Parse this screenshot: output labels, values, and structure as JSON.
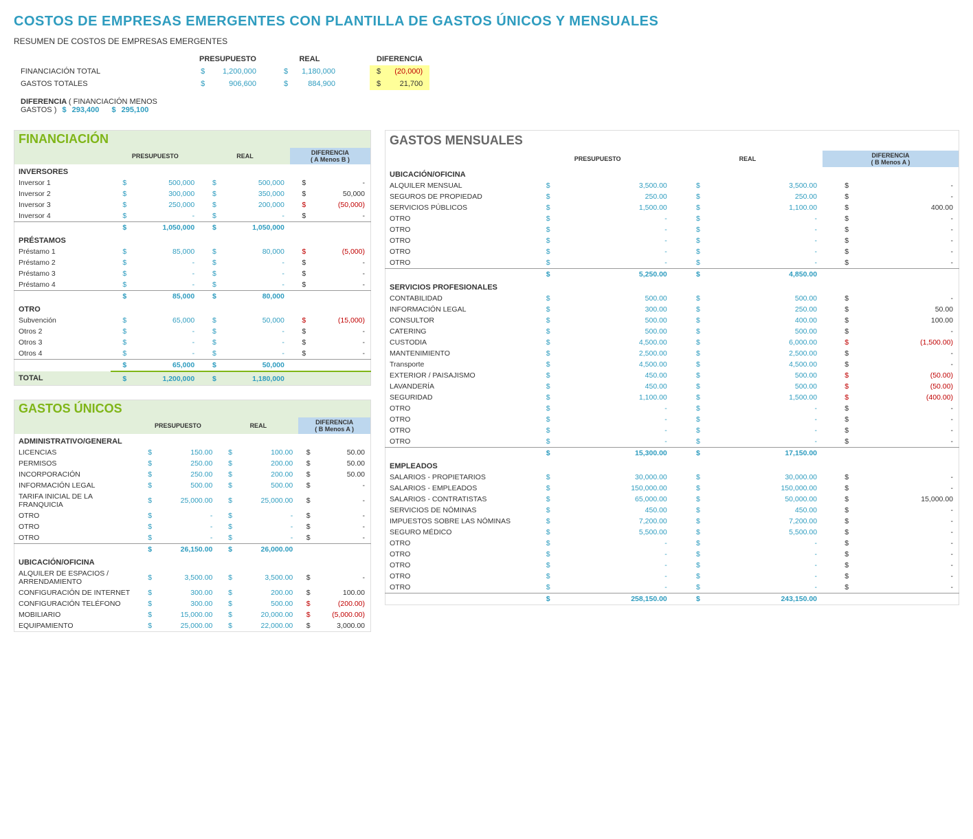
{
  "title": "COSTOS DE EMPRESAS EMERGENTES CON PLANTILLA DE GASTOS ÚNICOS Y MENSUALES",
  "subtitle": "RESUMEN DE COSTOS DE EMPRESAS EMERGENTES",
  "summary": {
    "headers": [
      "",
      "PRESUPUESTO",
      "",
      "REAL",
      "",
      "DIFERENCIA"
    ],
    "rows": [
      {
        "label": "FINANCIACIÓN TOTAL",
        "pres_sym": "$",
        "pres": "1,200,000",
        "real_sym": "$",
        "real": "1,180,000",
        "diff_sym": "$",
        "diff": "(20,000)",
        "diff_neg": true
      },
      {
        "label": "GASTOS TOTALES",
        "pres_sym": "$",
        "pres": "906,600",
        "real_sym": "$",
        "real": "884,900",
        "diff_sym": "$",
        "diff": "21,700",
        "diff_neg": false
      }
    ],
    "diferencia_label": "DIFERENCIA",
    "diferencia_note": "( FINANCIACIÓN MENOS GASTOS )",
    "diferencia_pres_sym": "$",
    "diferencia_pres": "293,400",
    "diferencia_real_sym": "$",
    "diferencia_real": "295,100"
  },
  "financiacion": {
    "title": "FINANCIACIÓN",
    "col_pres": "PRESUPUESTO",
    "col_real": "REAL",
    "col_diff": "DIFERENCIA\n( A Menos B )",
    "categories": [
      {
        "name": "INVERSORES",
        "items": [
          {
            "label": "Inversor 1",
            "pres": "500,000",
            "real": "500,000",
            "diff": "-",
            "neg": false
          },
          {
            "label": "Inversor 2",
            "pres": "300,000",
            "real": "350,000",
            "diff": "50,000",
            "neg": false
          },
          {
            "label": "Inversor 3",
            "pres": "250,000",
            "real": "200,000",
            "diff": "(50,000)",
            "neg": true
          },
          {
            "label": "Inversor 4",
            "pres": "-",
            "real": "-",
            "diff": "-",
            "neg": false
          }
        ],
        "subtotal_pres": "1,050,000",
        "subtotal_real": "1,050,000",
        "subtotal_diff": ""
      },
      {
        "name": "PRÉSTAMOS",
        "items": [
          {
            "label": "Préstamo 1",
            "pres": "85,000",
            "real": "80,000",
            "diff": "(5,000)",
            "neg": true
          },
          {
            "label": "Préstamo 2",
            "pres": "-",
            "real": "-",
            "diff": "-",
            "neg": false
          },
          {
            "label": "Préstamo 3",
            "pres": "-",
            "real": "-",
            "diff": "-",
            "neg": false
          },
          {
            "label": "Préstamo 4",
            "pres": "-",
            "real": "-",
            "diff": "-",
            "neg": false
          }
        ],
        "subtotal_pres": "85,000",
        "subtotal_real": "80,000",
        "subtotal_diff": ""
      },
      {
        "name": "OTRO",
        "items": [
          {
            "label": "Subvención",
            "pres": "65,000",
            "real": "50,000",
            "diff": "(15,000)",
            "neg": true
          },
          {
            "label": "Otros 2",
            "pres": "-",
            "real": "-",
            "diff": "-",
            "neg": false
          },
          {
            "label": "Otros 3",
            "pres": "-",
            "real": "-",
            "diff": "-",
            "neg": false
          },
          {
            "label": "Otros 4",
            "pres": "-",
            "real": "-",
            "diff": "-",
            "neg": false
          }
        ],
        "subtotal_pres": "65,000",
        "subtotal_real": "50,000",
        "subtotal_diff": ""
      }
    ],
    "total_label": "TOTAL",
    "total_pres": "1,200,000",
    "total_real": "1,180,000",
    "total_diff": ""
  },
  "gastos_unicos": {
    "title": "GASTOS ÚNICOS",
    "col_pres": "PRESUPUESTO",
    "col_real": "REAL",
    "col_diff": "DIFERENCIA\n( B Menos A )",
    "categories": [
      {
        "name": "ADMINISTRATIVO/GENERAL",
        "items": [
          {
            "label": "LICENCIAS",
            "pres": "150.00",
            "real": "100.00",
            "diff": "50.00",
            "neg": false
          },
          {
            "label": "PERMISOS",
            "pres": "250.00",
            "real": "200.00",
            "diff": "50.00",
            "neg": false
          },
          {
            "label": "INCORPORACIÓN",
            "pres": "250.00",
            "real": "200.00",
            "diff": "50.00",
            "neg": false
          },
          {
            "label": "INFORMACIÓN LEGAL",
            "pres": "500.00",
            "real": "500.00",
            "diff": "-",
            "neg": false
          },
          {
            "label": "TARIFA INICIAL DE LA FRANQUICIA",
            "pres": "25,000.00",
            "real": "25,000.00",
            "diff": "-",
            "neg": false
          },
          {
            "label": "OTRO",
            "pres": "-",
            "real": "-",
            "diff": "-",
            "neg": false
          },
          {
            "label": "OTRO",
            "pres": "-",
            "real": "-",
            "diff": "-",
            "neg": false
          },
          {
            "label": "OTRO",
            "pres": "-",
            "real": "-",
            "diff": "-",
            "neg": false
          }
        ],
        "subtotal_pres": "26,150.00",
        "subtotal_real": "26,000.00",
        "subtotal_diff": ""
      },
      {
        "name": "UBICACIÓN/OFICINA",
        "items": [
          {
            "label": "ALQUILER DE ESPACIOS / ARRENDAMIENTO",
            "pres": "3,500.00",
            "real": "3,500.00",
            "diff": "-",
            "neg": false
          },
          {
            "label": "CONFIGURACIÓN DE INTERNET",
            "pres": "300.00",
            "real": "200.00",
            "diff": "100.00",
            "neg": false
          },
          {
            "label": "CONFIGURACIÓN TELÉFONO",
            "pres": "300.00",
            "real": "500.00",
            "diff": "(200.00)",
            "neg": true
          },
          {
            "label": "MOBILIARIO",
            "pres": "15,000.00",
            "real": "20,000.00",
            "diff": "(5,000.00)",
            "neg": true
          },
          {
            "label": "EQUIPAMIENTO",
            "pres": "25,000.00",
            "real": "22,000.00",
            "diff": "3,000.00",
            "neg": false
          }
        ],
        "subtotal_pres": "",
        "subtotal_real": "",
        "subtotal_diff": ""
      }
    ]
  },
  "gastos_mensuales": {
    "title": "GASTOS MENSUALES",
    "col_pres": "PRESUPUESTO",
    "col_real": "REAL",
    "col_diff": "DIFERENCIA\n( B Menos A )",
    "categories": [
      {
        "name": "UBICACIÓN/OFICINA",
        "items": [
          {
            "label": "ALQUILER MENSUAL",
            "pres": "3,500.00",
            "real": "3,500.00",
            "diff": "-",
            "neg": false
          },
          {
            "label": "SEGUROS DE PROPIEDAD",
            "pres": "250.00",
            "real": "250.00",
            "diff": "-",
            "neg": false
          },
          {
            "label": "SERVICIOS PÚBLICOS",
            "pres": "1,500.00",
            "real": "1,100.00",
            "diff": "400.00",
            "neg": false
          },
          {
            "label": "OTRO",
            "pres": "-",
            "real": "-",
            "diff": "-",
            "neg": false
          },
          {
            "label": "OTRO",
            "pres": "-",
            "real": "-",
            "diff": "-",
            "neg": false
          },
          {
            "label": "OTRO",
            "pres": "-",
            "real": "-",
            "diff": "-",
            "neg": false
          },
          {
            "label": "OTRO",
            "pres": "-",
            "real": "-",
            "diff": "-",
            "neg": false
          },
          {
            "label": "OTRO",
            "pres": "-",
            "real": "-",
            "diff": "-",
            "neg": false
          }
        ],
        "subtotal_pres": "5,250.00",
        "subtotal_real": "4,850.00",
        "subtotal_diff": ""
      },
      {
        "name": "SERVICIOS PROFESIONALES",
        "items": [
          {
            "label": "CONTABILIDAD",
            "pres": "500.00",
            "real": "500.00",
            "diff": "-",
            "neg": false
          },
          {
            "label": "INFORMACIÓN LEGAL",
            "pres": "300.00",
            "real": "250.00",
            "diff": "50.00",
            "neg": false
          },
          {
            "label": "CONSULTOR",
            "pres": "500.00",
            "real": "400.00",
            "diff": "100.00",
            "neg": false
          },
          {
            "label": "CATERING",
            "pres": "500.00",
            "real": "500.00",
            "diff": "-",
            "neg": false
          },
          {
            "label": "CUSTODIA",
            "pres": "4,500.00",
            "real": "6,000.00",
            "diff": "(1,500.00)",
            "neg": true
          },
          {
            "label": "MANTENIMIENTO",
            "pres": "2,500.00",
            "real": "2,500.00",
            "diff": "-",
            "neg": false
          },
          {
            "label": "Transporte",
            "pres": "4,500.00",
            "real": "4,500.00",
            "diff": "-",
            "neg": false
          },
          {
            "label": "EXTERIOR / PAISAJISMO",
            "pres": "450.00",
            "real": "500.00",
            "diff": "(50.00)",
            "neg": true
          },
          {
            "label": "LAVANDERÍA",
            "pres": "450.00",
            "real": "500.00",
            "diff": "(50.00)",
            "neg": true
          },
          {
            "label": "SEGURIDAD",
            "pres": "1,100.00",
            "real": "1,500.00",
            "diff": "(400.00)",
            "neg": true
          },
          {
            "label": "OTRO",
            "pres": "-",
            "real": "-",
            "diff": "-",
            "neg": false
          },
          {
            "label": "OTRO",
            "pres": "-",
            "real": "-",
            "diff": "-",
            "neg": false
          },
          {
            "label": "OTRO",
            "pres": "-",
            "real": "-",
            "diff": "-",
            "neg": false
          },
          {
            "label": "OTRO",
            "pres": "-",
            "real": "-",
            "diff": "-",
            "neg": false
          }
        ],
        "subtotal_pres": "15,300.00",
        "subtotal_real": "17,150.00",
        "subtotal_diff": ""
      },
      {
        "name": "EMPLEADOS",
        "items": [
          {
            "label": "SALARIOS - PROPIETARIOS",
            "pres": "30,000.00",
            "real": "30,000.00",
            "diff": "-",
            "neg": false
          },
          {
            "label": "SALARIOS - EMPLEADOS",
            "pres": "150,000.00",
            "real": "150,000.00",
            "diff": "-",
            "neg": false
          },
          {
            "label": "SALARIOS - CONTRATISTAS",
            "pres": "65,000.00",
            "real": "50,000.00",
            "diff": "15,000.00",
            "neg": false
          },
          {
            "label": "SERVICIOS DE NÓMINAS",
            "pres": "450.00",
            "real": "450.00",
            "diff": "-",
            "neg": false
          },
          {
            "label": "IMPUESTOS SOBRE LAS NÓMINAS",
            "pres": "7,200.00",
            "real": "7,200.00",
            "diff": "-",
            "neg": false
          },
          {
            "label": "SEGURO MÉDICO",
            "pres": "5,500.00",
            "real": "5,500.00",
            "diff": "-",
            "neg": false
          },
          {
            "label": "OTRO",
            "pres": "-",
            "real": "-",
            "diff": "-",
            "neg": false
          },
          {
            "label": "OTRO",
            "pres": "-",
            "real": "-",
            "diff": "-",
            "neg": false
          },
          {
            "label": "OTRO",
            "pres": "-",
            "real": "-",
            "diff": "-",
            "neg": false
          },
          {
            "label": "OTRO",
            "pres": "-",
            "real": "-",
            "diff": "-",
            "neg": false
          },
          {
            "label": "OTRO",
            "pres": "-",
            "real": "-",
            "diff": "-",
            "neg": false
          }
        ],
        "subtotal_pres": "258,150.00",
        "subtotal_real": "243,150.00",
        "subtotal_diff": ""
      }
    ]
  }
}
